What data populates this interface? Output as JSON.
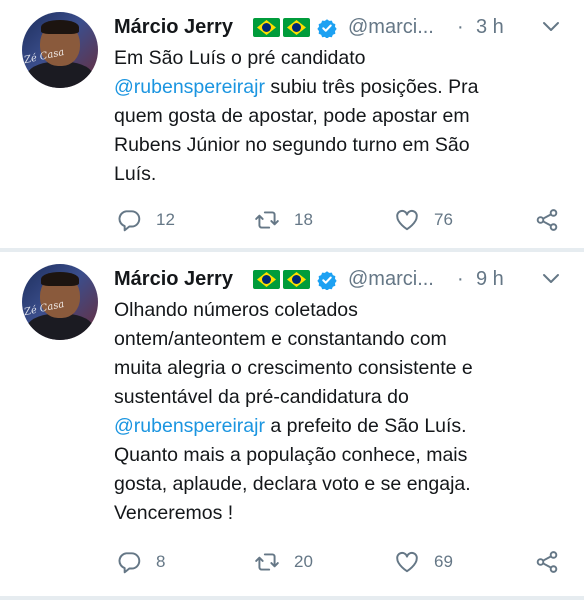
{
  "tweets": [
    {
      "author": "Márcio Jerry",
      "handle": "@marci...",
      "separator": "·",
      "time": "3 h",
      "avatar_caption": "Zé Casa",
      "lines": [
        "Em São Luís o pré candidato",
        "subiu três posições. Pra",
        "quem gosta de apostar, pode apostar em",
        "Rubens Júnior no segundo turno em São",
        "Luís."
      ],
      "mention": "@rubenspereirajr",
      "reply_count": "12",
      "retweet_count": "18",
      "like_count": "76"
    },
    {
      "author": "Márcio Jerry",
      "handle": "@marci...",
      "separator": "·",
      "time": "9 h",
      "avatar_caption": "Zé Casa",
      "lines": [
        "Olhando números coletados",
        "ontem/anteontem e constantando com",
        "muita alegria o crescimento consistente e",
        "sustentável da pré-candidatura do",
        "a prefeito de São Luís.",
        "Quanto mais a população conhece, mais",
        "gosta, aplaude, declara voto e se engaja.",
        "Venceremos !"
      ],
      "mention": "@rubenspereirajr",
      "reply_count": "8",
      "retweet_count": "20",
      "like_count": "69"
    }
  ],
  "colors": {
    "mention": "#1b95e0",
    "secondary_text": "#657786",
    "verified": "#1da1f2",
    "separator": "#e6ecf0"
  },
  "icons": [
    "reply-icon",
    "retweet-icon",
    "like-icon",
    "share-icon",
    "verified-badge-icon",
    "chevron-down-icon",
    "brazil-flag-icon"
  ]
}
